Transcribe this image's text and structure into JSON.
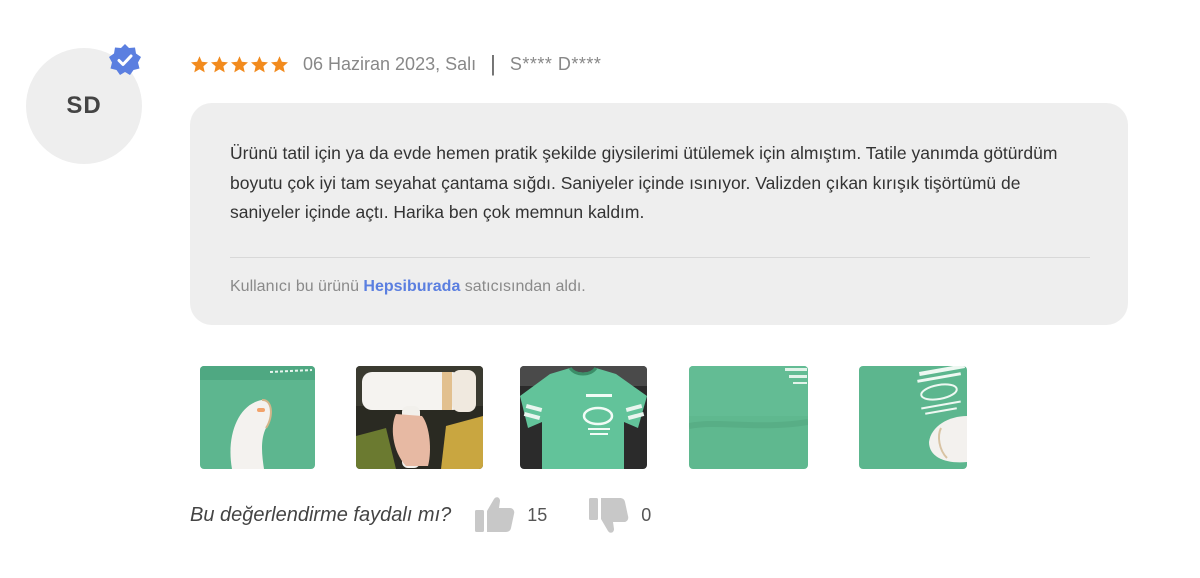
{
  "reviewer": {
    "initials": "SD",
    "verified": true,
    "masked_name": "S**** D****"
  },
  "rating": {
    "stars": 5,
    "max": 5
  },
  "date": "06 Haziran 2023, Salı",
  "separator": "|",
  "review": {
    "text": "Ürünü tatil için ya da evde hemen pratik şekilde giysilerimi ütülemek için almıştım. Tatile yanımda götürdüm boyutu çok iyi tam seyahat çantama sığdı. Saniyeler içinde ısınıyor. Valizden çıkan kırışık tişörtümü de saniyeler içinde açtı. Harika ben çok memnun kaldım."
  },
  "seller": {
    "prefix": "Kullanıcı bu ürünü ",
    "name": "Hepsiburada",
    "suffix": " satıcısından aldı."
  },
  "photos": [
    {
      "icon": "green-shirt-steamer-photo"
    },
    {
      "icon": "white-steamer-in-hand-photo"
    },
    {
      "icon": "green-tshirt-photo"
    },
    {
      "icon": "green-fabric-closeup-photo"
    },
    {
      "icon": "green-shirt-print-steamer-photo"
    }
  ],
  "helpful": {
    "question": "Bu değerlendirme faydalı mı?",
    "likes": "15",
    "dislikes": "0"
  },
  "colors": {
    "star": "#f28b1e",
    "verified_badge": "#5b7fe0",
    "link": "#5b7fe0",
    "bubble_bg": "#eeeeee",
    "shirt_green": "#5fb890"
  }
}
